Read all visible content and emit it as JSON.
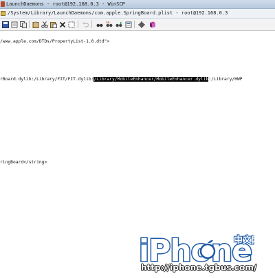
{
  "window": {
    "title": "LaunchDaemons - root@192.168.0.3 - WinSCP"
  },
  "pathbar": {
    "text": "/System/Library/LaunchDaemons/com.apple.SpringBoard.plist - root@192.168.0.3"
  },
  "toolbar": {
    "buttons": [
      "save-icon",
      "open-icon",
      "copy-icon",
      "cut-icon",
      "paste-icon",
      "delete-icon",
      "undo-icon",
      "find-icon",
      "replace-icon",
      "find-next-icon",
      "goto-icon",
      "settings-icon",
      "help-icon"
    ]
  },
  "editor": {
    "lines": {
      "dtd": "/www.apple.com/DTDs/PropertyList-1.0.dtd\">",
      "dylib_before": "rBoard.dylib:/Library/FIT/FIT.dylib:",
      "dylib_selected": "/Library/MobileEnhancer/MobileEnhancer.dylib",
      "dylib_after": ":/Library/HWP",
      "string": "ringBoard</string>"
    }
  },
  "watermark": {
    "logo": "iPhone",
    "logo_tag": "中文网",
    "url": "http://iphone.tgbus.com/"
  },
  "colors": {
    "selection_bg": "#000000",
    "watermark_blue": "#1e5aa8"
  }
}
